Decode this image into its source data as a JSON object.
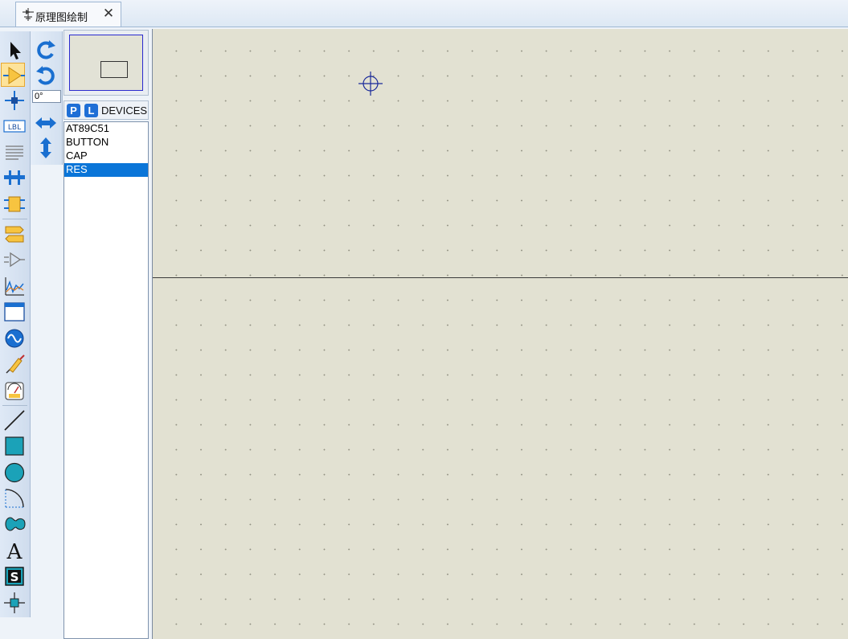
{
  "tab": {
    "title": "原理图绘制",
    "close_label": "✕"
  },
  "toolbar": {
    "primary_tools": [
      {
        "name": "selection-mode"
      },
      {
        "name": "component-mode"
      },
      {
        "name": "junction-dot-mode"
      },
      {
        "name": "wire-label-mode"
      },
      {
        "name": "text-script-mode"
      },
      {
        "name": "buses-mode"
      },
      {
        "name": "subcircuit-mode"
      },
      {
        "name": "terminals-mode"
      },
      {
        "name": "device-pins-mode"
      },
      {
        "name": "graph-mode"
      },
      {
        "name": "tape-recorder-mode"
      },
      {
        "name": "generator-mode"
      },
      {
        "name": "voltage-probe-mode"
      },
      {
        "name": "virtual-instruments-mode"
      },
      {
        "name": "2d-line-mode"
      },
      {
        "name": "2d-box-mode"
      },
      {
        "name": "2d-circle-mode"
      },
      {
        "name": "2d-arc-mode"
      },
      {
        "name": "2d-path-mode"
      },
      {
        "name": "2d-text-mode"
      },
      {
        "name": "2d-symbol-mode"
      },
      {
        "name": "2d-markers-mode"
      }
    ],
    "rotation_value": "0°"
  },
  "device_panel": {
    "p_button": "P",
    "l_button": "L",
    "title": "DEVICES",
    "items": [
      "AT89C51",
      "BUTTON",
      "CAP",
      "RES"
    ],
    "selected_index": 3
  },
  "colors": {
    "canvas_bg": "#e2e1d2",
    "selection_blue": "#0a75d8",
    "active_tool": "#fde39a"
  }
}
